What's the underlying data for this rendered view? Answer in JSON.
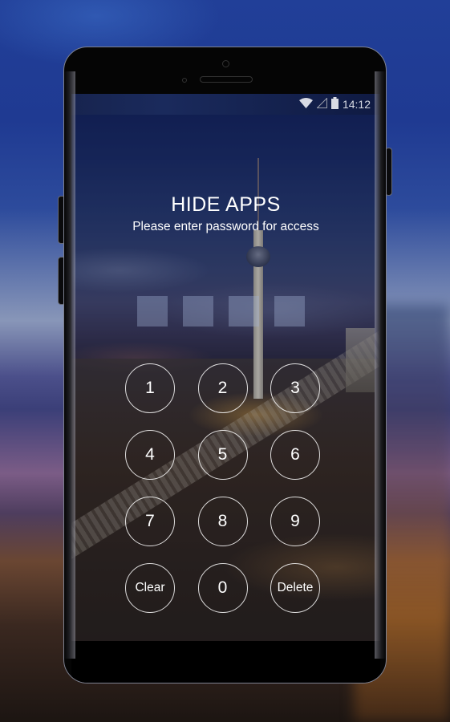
{
  "status_bar": {
    "wifi_icon": "wifi-icon",
    "signal_icon": "cell-signal-icon",
    "battery_icon": "battery-icon",
    "time": "14:12"
  },
  "lock_screen": {
    "title": "HIDE APPS",
    "subtitle": "Please enter password for access",
    "pin_length": 4,
    "pin_entered": 0
  },
  "keypad": {
    "keys": [
      {
        "label": "1",
        "name": "key-1"
      },
      {
        "label": "2",
        "name": "key-2"
      },
      {
        "label": "3",
        "name": "key-3"
      },
      {
        "label": "4",
        "name": "key-4"
      },
      {
        "label": "5",
        "name": "key-5"
      },
      {
        "label": "6",
        "name": "key-6"
      },
      {
        "label": "7",
        "name": "key-7"
      },
      {
        "label": "8",
        "name": "key-8"
      },
      {
        "label": "9",
        "name": "key-9"
      },
      {
        "label": "Clear",
        "name": "clear-button"
      },
      {
        "label": "0",
        "name": "key-0"
      },
      {
        "label": "Delete",
        "name": "delete-button"
      }
    ]
  },
  "colors": {
    "background_top": "#213f98",
    "text": "#ffffff",
    "pin_box": "#a0afd2"
  }
}
